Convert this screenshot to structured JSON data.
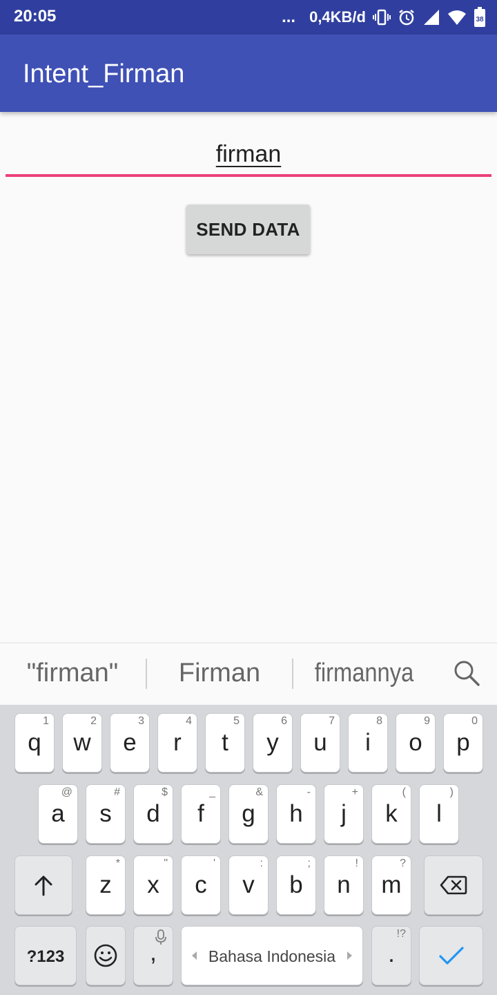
{
  "status_bar": {
    "time": "20:05",
    "dots": "...",
    "network_speed": "0,4KB/d",
    "battery_level": "38",
    "icons": [
      "vibrate-icon",
      "alarm-icon",
      "signal-icon",
      "wifi-icon",
      "battery-icon"
    ]
  },
  "app_bar": {
    "title": "Intent_Firman",
    "color": "#3f51b5"
  },
  "status_bar_color": "#303f9f",
  "form": {
    "input_value": "firman",
    "input_accent": "#e91e63",
    "send_button_label": "SEND DATA"
  },
  "suggestions": {
    "items": [
      "\"firman\"",
      "Firman",
      "firmannya"
    ],
    "search_icon": "search-icon"
  },
  "keyboard": {
    "row1": [
      {
        "key": "q",
        "hint": "1"
      },
      {
        "key": "w",
        "hint": "2"
      },
      {
        "key": "e",
        "hint": "3"
      },
      {
        "key": "r",
        "hint": "4"
      },
      {
        "key": "t",
        "hint": "5"
      },
      {
        "key": "y",
        "hint": "6"
      },
      {
        "key": "u",
        "hint": "7"
      },
      {
        "key": "i",
        "hint": "8"
      },
      {
        "key": "o",
        "hint": "9"
      },
      {
        "key": "p",
        "hint": "0"
      }
    ],
    "row2": [
      {
        "key": "a",
        "hint": "@"
      },
      {
        "key": "s",
        "hint": "#"
      },
      {
        "key": "d",
        "hint": "$"
      },
      {
        "key": "f",
        "hint": "_"
      },
      {
        "key": "g",
        "hint": "&"
      },
      {
        "key": "h",
        "hint": "-"
      },
      {
        "key": "j",
        "hint": "+"
      },
      {
        "key": "k",
        "hint": "("
      },
      {
        "key": "l",
        "hint": ")"
      }
    ],
    "row3": [
      {
        "key": "z",
        "hint": "*"
      },
      {
        "key": "x",
        "hint": "\""
      },
      {
        "key": "c",
        "hint": "'"
      },
      {
        "key": "v",
        "hint": ":"
      },
      {
        "key": "b",
        "hint": ";"
      },
      {
        "key": "n",
        "hint": "!"
      },
      {
        "key": "m",
        "hint": "?"
      }
    ],
    "symbols_label": "?123",
    "comma_label": ",",
    "space_label": "Bahasa Indonesia",
    "period_label": ".",
    "period_hint": "!?",
    "enter_color": "#2196f3"
  }
}
